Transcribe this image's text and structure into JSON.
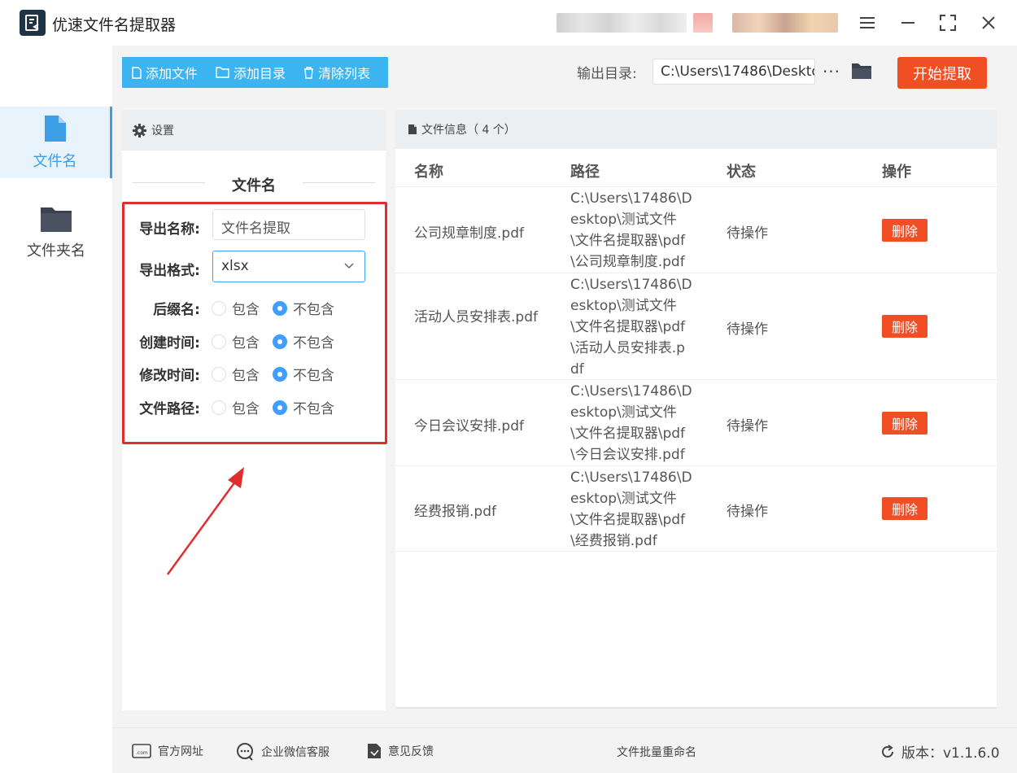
{
  "app": {
    "title": "优速文件名提取器"
  },
  "nav": [
    {
      "label": "文件名",
      "icon": "file-icon",
      "active": true
    },
    {
      "label": "文件夹名",
      "icon": "folder-icon",
      "active": false
    }
  ],
  "toolbar": {
    "add_file": "添加文件",
    "add_dir": "添加目录",
    "clear_list": "清除列表",
    "output_label": "输出目录:",
    "output_value": "C:\\Users\\17486\\Deskto",
    "more": "···",
    "start": "开始提取"
  },
  "settings": {
    "header": "设置",
    "section_title": "文件名",
    "export_name_label": "导出名称:",
    "export_name_value": "文件名提取",
    "export_format_label": "导出格式:",
    "export_format_value": "xlsx",
    "options": [
      {
        "label": "后缀名:",
        "include": "包含",
        "exclude": "不包含",
        "selected": "exclude"
      },
      {
        "label": "创建时间:",
        "include": "包含",
        "exclude": "不包含",
        "selected": "exclude"
      },
      {
        "label": "修改时间:",
        "include": "包含",
        "exclude": "不包含",
        "selected": "exclude"
      },
      {
        "label": "文件路径:",
        "include": "包含",
        "exclude": "不包含",
        "selected": "exclude"
      }
    ]
  },
  "fileinfo": {
    "header": "文件信息（ 4 个）",
    "columns": [
      "名称",
      "路径",
      "状态",
      "操作"
    ],
    "rows": [
      {
        "name": "公司规章制度.pdf",
        "path": "C:\\Users\\17486\\Desktop\\测试文件\\文件名提取器\\pdf\\公司规章制度.pdf",
        "status": "待操作",
        "action": "删除"
      },
      {
        "name": "活动人员安排表.pdf",
        "path": "C:\\Users\\17486\\Desktop\\测试文件\\文件名提取器\\pdf\\活动人员安排表.pdf",
        "status": "待操作",
        "action": "删除"
      },
      {
        "name": "今日会议安排.pdf",
        "path": "C:\\Users\\17486\\Desktop\\测试文件\\文件名提取器\\pdf\\今日会议安排.pdf",
        "status": "待操作",
        "action": "删除"
      },
      {
        "name": "经费报销.pdf",
        "path": "C:\\Users\\17486\\Desktop\\测试文件\\文件名提取器\\pdf\\经费报销.pdf",
        "status": "待操作",
        "action": "删除"
      }
    ]
  },
  "footer": {
    "website": "官方网址",
    "wechat": "企业微信客服",
    "feedback": "意见反馈",
    "center": "文件批量重命名",
    "version": "版本：v1.1.6.0"
  },
  "colors": {
    "accent": "#3cb4ef",
    "primary": "#409eff",
    "danger": "#f04e23",
    "highlight": "#e02e2e"
  }
}
